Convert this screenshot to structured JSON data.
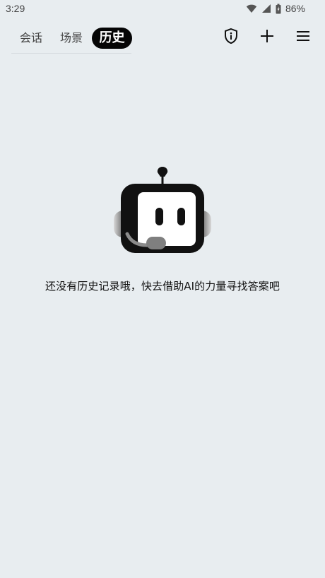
{
  "status_bar": {
    "time": "3:29",
    "battery": "86%"
  },
  "tabs": [
    {
      "label": "会话"
    },
    {
      "label": "场景"
    },
    {
      "label": "历史"
    }
  ],
  "empty_state": {
    "message": "还没有历史记录哦，快去借助AI的力量寻找答案吧"
  }
}
